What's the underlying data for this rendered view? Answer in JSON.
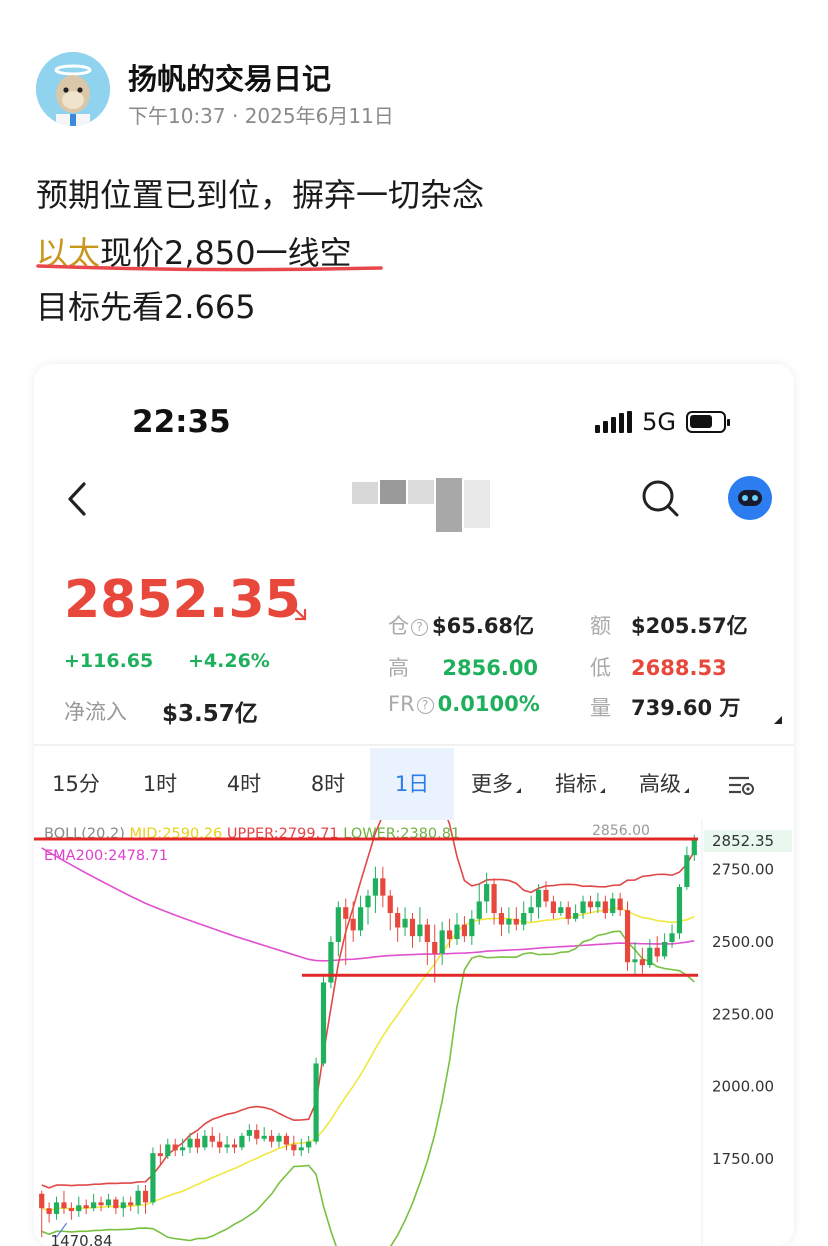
{
  "post": {
    "author": "扬帆的交易日记",
    "time": "下午10:37 · 2025年6月11日",
    "line1": "预期位置已到位，摒弃一切杂念",
    "line2_highlight": "以太",
    "line2_rest": "现价2,850一线空",
    "line3": "目标先看2.665"
  },
  "phone": {
    "status_time": "22:35",
    "network": "5G",
    "battery_level": 0.7
  },
  "ticker": {
    "price": "2852.35",
    "change_abs": "+116.65",
    "change_pct": "+4.26%",
    "netflow_label": "净流入",
    "netflow_value": "$3.57亿",
    "stats": {
      "oi_label": "仓",
      "oi_value": "$65.68亿",
      "amount_label": "额",
      "amount_value": "$205.57亿",
      "high_label": "高",
      "high_value": "2856.00",
      "low_label": "低",
      "low_value": "2688.53",
      "fr_label": "FR",
      "fr_value": "0.0100%",
      "vol_label": "量",
      "vol_value": "739.60 万"
    }
  },
  "tabs": [
    "15分",
    "1时",
    "4时",
    "8时",
    "1日",
    "更多",
    "指标",
    "高级"
  ],
  "active_tab": "1日",
  "colors": {
    "up": "#1eb05c",
    "down": "#e8483c",
    "boll_mid": "#f0e840",
    "boll_upper": "#e04848",
    "boll_lower": "#78c040",
    "ema": "#e050d0",
    "accent": "#2b7de9"
  },
  "chart_data": {
    "type": "candlestick",
    "legend": {
      "boll": "BOLL(20,2)",
      "mid": "MID:2590.26",
      "upper": "UPPER:2799.71",
      "lower": "LOWER:2380.81",
      "ema": "EMA200:2478.71"
    },
    "y_ticks": [
      "2750.00",
      "2500.00",
      "2250.00",
      "2000.00",
      "1750.00"
    ],
    "y_tick_values": [
      2750,
      2500,
      2250,
      2000,
      1750
    ],
    "ylim": [
      1470,
      2880
    ],
    "current_price_label": "2852.35",
    "high_marker_label": "2856.00",
    "low_marker_label": "1470.84",
    "horizontal_lines": [
      2856,
      2385
    ],
    "candles": [
      [
        1630,
        1580,
        1640,
        1480
      ],
      [
        1580,
        1560,
        1600,
        1530
      ],
      [
        1560,
        1600,
        1620,
        1540
      ],
      [
        1600,
        1580,
        1640,
        1560
      ],
      [
        1580,
        1570,
        1600,
        1540
      ],
      [
        1570,
        1590,
        1620,
        1550
      ],
      [
        1590,
        1580,
        1610,
        1560
      ],
      [
        1580,
        1600,
        1630,
        1570
      ],
      [
        1600,
        1590,
        1620,
        1570
      ],
      [
        1590,
        1610,
        1630,
        1580
      ],
      [
        1610,
        1580,
        1620,
        1560
      ],
      [
        1580,
        1600,
        1620,
        1550
      ],
      [
        1600,
        1590,
        1620,
        1570
      ],
      [
        1590,
        1640,
        1660,
        1560
      ],
      [
        1640,
        1600,
        1660,
        1560
      ],
      [
        1600,
        1770,
        1790,
        1590
      ],
      [
        1770,
        1760,
        1800,
        1730
      ],
      [
        1760,
        1800,
        1820,
        1750
      ],
      [
        1800,
        1780,
        1820,
        1760
      ],
      [
        1780,
        1790,
        1820,
        1760
      ],
      [
        1790,
        1820,
        1840,
        1770
      ],
      [
        1820,
        1790,
        1840,
        1770
      ],
      [
        1790,
        1830,
        1850,
        1780
      ],
      [
        1830,
        1810,
        1860,
        1790
      ],
      [
        1810,
        1790,
        1840,
        1770
      ],
      [
        1790,
        1800,
        1830,
        1770
      ],
      [
        1800,
        1790,
        1820,
        1770
      ],
      [
        1790,
        1830,
        1840,
        1780
      ],
      [
        1830,
        1850,
        1870,
        1810
      ],
      [
        1850,
        1820,
        1870,
        1800
      ],
      [
        1820,
        1830,
        1860,
        1810
      ],
      [
        1830,
        1810,
        1850,
        1790
      ],
      [
        1810,
        1830,
        1840,
        1790
      ],
      [
        1830,
        1800,
        1840,
        1780
      ],
      [
        1800,
        1780,
        1830,
        1760
      ],
      [
        1780,
        1790,
        1820,
        1760
      ],
      [
        1790,
        1810,
        1830,
        1770
      ],
      [
        1810,
        2080,
        2100,
        1800
      ],
      [
        2080,
        2360,
        2380,
        2070
      ],
      [
        2360,
        2500,
        2520,
        2340
      ],
      [
        2500,
        2620,
        2640,
        2450
      ],
      [
        2620,
        2580,
        2650,
        2420
      ],
      [
        2580,
        2540,
        2640,
        2500
      ],
      [
        2540,
        2620,
        2660,
        2520
      ],
      [
        2620,
        2660,
        2680,
        2560
      ],
      [
        2660,
        2720,
        2760,
        2600
      ],
      [
        2720,
        2660,
        2760,
        2620
      ],
      [
        2660,
        2600,
        2680,
        2540
      ],
      [
        2600,
        2550,
        2620,
        2500
      ],
      [
        2550,
        2580,
        2620,
        2520
      ],
      [
        2580,
        2520,
        2600,
        2480
      ],
      [
        2520,
        2560,
        2620,
        2500
      ],
      [
        2560,
        2500,
        2580,
        2420
      ],
      [
        2500,
        2460,
        2560,
        2360
      ],
      [
        2460,
        2540,
        2570,
        2420
      ],
      [
        2540,
        2510,
        2580,
        2480
      ],
      [
        2510,
        2560,
        2600,
        2490
      ],
      [
        2560,
        2520,
        2590,
        2500
      ],
      [
        2520,
        2580,
        2610,
        2490
      ],
      [
        2580,
        2640,
        2700,
        2560
      ],
      [
        2640,
        2700,
        2740,
        2600
      ],
      [
        2700,
        2600,
        2720,
        2560
      ],
      [
        2600,
        2560,
        2620,
        2520
      ],
      [
        2560,
        2580,
        2620,
        2530
      ],
      [
        2580,
        2560,
        2620,
        2540
      ],
      [
        2560,
        2600,
        2640,
        2540
      ],
      [
        2600,
        2620,
        2660,
        2570
      ],
      [
        2620,
        2680,
        2700,
        2580
      ],
      [
        2680,
        2640,
        2710,
        2620
      ],
      [
        2640,
        2600,
        2660,
        2580
      ],
      [
        2600,
        2620,
        2640,
        2590
      ],
      [
        2620,
        2580,
        2640,
        2560
      ],
      [
        2580,
        2600,
        2630,
        2570
      ],
      [
        2600,
        2640,
        2660,
        2580
      ],
      [
        2640,
        2620,
        2660,
        2600
      ],
      [
        2620,
        2640,
        2670,
        2600
      ],
      [
        2640,
        2600,
        2660,
        2580
      ],
      [
        2600,
        2650,
        2670,
        2590
      ],
      [
        2650,
        2610,
        2670,
        2590
      ],
      [
        2610,
        2430,
        2640,
        2400
      ],
      [
        2430,
        2440,
        2500,
        2390
      ],
      [
        2440,
        2420,
        2480,
        2390
      ],
      [
        2420,
        2480,
        2510,
        2410
      ],
      [
        2480,
        2450,
        2520,
        2430
      ],
      [
        2450,
        2500,
        2530,
        2440
      ],
      [
        2500,
        2530,
        2560,
        2480
      ],
      [
        2530,
        2690,
        2700,
        2510
      ],
      [
        2690,
        2800,
        2830,
        2680
      ],
      [
        2800,
        2852,
        2870,
        2780
      ]
    ]
  }
}
